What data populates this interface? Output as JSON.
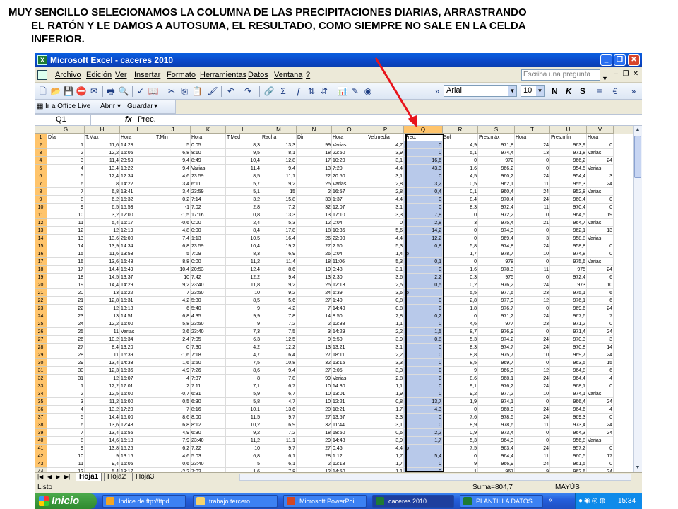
{
  "caption": {
    "line1": "MUY SENCILLO SELECIONAMOS LA COLUMNA DE LAS PRECIPITACIONES DIARIAS, ARRASTRANDO",
    "line2": "EL RATÓN Y LE DAMOS A AUTOSUMA, EL RESULTADO, COMO SIEMPRE NO SALE EN LA CELDA",
    "line3": "INFERIOR."
  },
  "window": {
    "title": "Microsoft Excel - caceres 2010"
  },
  "menu": [
    "Archivo",
    "Edición",
    "Ver",
    "Insertar",
    "Formato",
    "Herramientas",
    "Datos",
    "Ventana",
    "?"
  ],
  "help_placeholder": "Escriba una pregunta",
  "toolbar": {
    "font": "Arial",
    "size": "10",
    "bold": "N",
    "italic": "K",
    "underline": "S"
  },
  "toolbar2": {
    "office_live": "Ir a Office Live",
    "open": "Abrir",
    "save": "Guardar"
  },
  "formula": {
    "namebox": "Q1",
    "fx": "fx",
    "value": "Prec."
  },
  "columns": [
    "G",
    "H",
    "I",
    "J",
    "K",
    "L",
    "M",
    "N",
    "O",
    "P",
    "Q",
    "R",
    "S",
    "T",
    "U",
    "V"
  ],
  "headers": [
    "Día",
    "T.Max",
    "Hora",
    "T.Min",
    "Hora",
    "T.Med",
    "Racha",
    "Dir",
    "Hora",
    "Vel.media",
    "Prec.",
    "Sol",
    "Pres.máx",
    "Hora",
    "Pres.mín",
    "Hora"
  ],
  "rows": [
    [
      "1",
      "11,6",
      "14:28",
      "5",
      "0:05",
      "8,3",
      "13,3",
      "99",
      "Varias",
      "4,7",
      "0",
      "4,9",
      "971,8",
      "24",
      "963,9",
      "0"
    ],
    [
      "2",
      "12,2",
      "15:05",
      "6,8",
      "8:10",
      "9,5",
      "8,1",
      "18",
      "22:50",
      "3,9",
      "0",
      "5,1",
      "974,4",
      "13",
      "971,8",
      "Varias"
    ],
    [
      "3",
      "11,4",
      "23:59",
      "9,4",
      "8:49",
      "10,4",
      "12,8",
      "17",
      "10:20",
      "3,1",
      "16,6",
      "0",
      "972",
      "0",
      "966,2",
      "24"
    ],
    [
      "4",
      "13,4",
      "13:22",
      "9,4",
      "Varias",
      "11,4",
      "9,4",
      "13",
      "7:20",
      "4,4",
      "43,3",
      "1,6",
      "966,2",
      "0",
      "954,5",
      "Varias"
    ],
    [
      "5",
      "12,4",
      "12:34",
      "4,6",
      "23:59",
      "8,5",
      "11,1",
      "22",
      "20:50",
      "3,1",
      "0",
      "4,5",
      "960,2",
      "24",
      "954,4",
      "3"
    ],
    [
      "6",
      "8",
      "14:22",
      "3,4",
      "6:11",
      "5,7",
      "9,2",
      "25",
      "Varias",
      "2,8",
      "3,2",
      "0,5",
      "962,1",
      "11",
      "955,3",
      "24"
    ],
    [
      "7",
      "6,8",
      "13:41",
      "3,4",
      "23:59",
      "5,1",
      "15",
      "2",
      "16:57",
      "2,8",
      "0,4",
      "0,1",
      "960,4",
      "24",
      "952,8",
      "Varias"
    ],
    [
      "8",
      "6,2",
      "15:32",
      "0,2",
      "7:14",
      "3,2",
      "15,8",
      "33",
      "1:37",
      "4,4",
      "0",
      "8,4",
      "970,4",
      "24",
      "960,4",
      "0"
    ],
    [
      "9",
      "6,5",
      "15:53",
      "-1",
      "7:02",
      "2,8",
      "7,2",
      "32",
      "12:07",
      "3,1",
      "0",
      "8,3",
      "972,4",
      "11",
      "970,4",
      "0"
    ],
    [
      "10",
      "3,2",
      "12:00",
      "-1,5",
      "17:16",
      "0,8",
      "13,3",
      "13",
      "17:10",
      "3,3",
      "7,8",
      "0",
      "972,2",
      "0",
      "964,5",
      "19"
    ],
    [
      "11",
      "5,4",
      "16:17",
      "-0,6",
      "0:00",
      "2,4",
      "5,3",
      "12",
      "0:04",
      "0",
      "2,8",
      "3",
      "975,4",
      "21",
      "964,7",
      "Varias"
    ],
    [
      "12",
      "12",
      "12:19",
      "4,8",
      "0:00",
      "8,4",
      "17,8",
      "18",
      "10:35",
      "5,6",
      "14,2",
      "0",
      "974,3",
      "0",
      "962,1",
      "13"
    ],
    [
      "13",
      "13,6",
      "21:00",
      "7,4",
      "1:13",
      "10,5",
      "16,4",
      "26",
      "22:00",
      "4,4",
      "12,2",
      "0",
      "969,4",
      "3",
      "958,8",
      "Varias"
    ],
    [
      "14",
      "13,9",
      "14:34",
      "6,8",
      "23:59",
      "10,4",
      "19,2",
      "27",
      "2:50",
      "5,3",
      "0,8",
      "5,8",
      "974,8",
      "24",
      "958,8",
      "0"
    ],
    [
      "15",
      "11,6",
      "13:53",
      "5",
      "7:09",
      "8,3",
      "6,9",
      "26",
      "0:04",
      "1,4",
      "Ip",
      "1,7",
      "978,7",
      "10",
      "974,8",
      "0"
    ],
    [
      "16",
      "13,6",
      "16:48",
      "8,8",
      "0:00",
      "11,2",
      "11,4",
      "18",
      "11:06",
      "5,3",
      "0,1",
      "0",
      "978",
      "0",
      "975,6",
      "Varias"
    ],
    [
      "17",
      "14,4",
      "15:49",
      "10,4",
      "20:53",
      "12,4",
      "8,6",
      "19",
      "0:48",
      "3,1",
      "0",
      "1,6",
      "978,3",
      "11",
      "975",
      "24"
    ],
    [
      "18",
      "14,5",
      "13:37",
      "10",
      "7:42",
      "12,2",
      "9,4",
      "13",
      "2:30",
      "3,6",
      "2,2",
      "0,3",
      "975",
      "0",
      "972,4",
      "6"
    ],
    [
      "19",
      "14,4",
      "14:29",
      "9,2",
      "23:40",
      "11,8",
      "9,2",
      "25",
      "12:13",
      "2,5",
      "0,5",
      "0,2",
      "976,2",
      "24",
      "973",
      "10"
    ],
    [
      "20",
      "13",
      "15:22",
      "7",
      "23:50",
      "10",
      "9,2",
      "24",
      "5:39",
      "3,6",
      "Ip",
      "5,5",
      "977,6",
      "23",
      "975,1",
      "6"
    ],
    [
      "21",
      "12,8",
      "15:31",
      "4,2",
      "5:30",
      "8,5",
      "5,6",
      "27",
      "1:40",
      "0,8",
      "0",
      "2,8",
      "977,9",
      "12",
      "976,1",
      "6"
    ],
    [
      "22",
      "12",
      "13:18",
      "6",
      "5:40",
      "9",
      "4,2",
      "7",
      "14:40",
      "0,8",
      "0",
      "1,8",
      "976,7",
      "0",
      "969,6",
      "24"
    ],
    [
      "23",
      "13",
      "14:51",
      "6,8",
      "4:35",
      "9,9",
      "7,8",
      "14",
      "8:50",
      "2,8",
      "0,2",
      "0",
      "971,2",
      "24",
      "967,6",
      "7"
    ],
    [
      "24",
      "12,2",
      "16:00",
      "5,8",
      "23:50",
      "9",
      "7,2",
      "2",
      "12:38",
      "1,1",
      "0",
      "4,6",
      "977",
      "23",
      "971,2",
      "0"
    ],
    [
      "25",
      "11",
      "Varias",
      "3,6",
      "23:40",
      "7,3",
      "7,5",
      "3",
      "14:29",
      "2,2",
      "1,5",
      "8,7",
      "976,9",
      "0",
      "971,4",
      "24"
    ],
    [
      "26",
      "10,2",
      "15:34",
      "2,4",
      "7:05",
      "6,3",
      "12,5",
      "9",
      "5:50",
      "3,9",
      "0,8",
      "5,3",
      "974,2",
      "24",
      "970,3",
      "3"
    ],
    [
      "27",
      "8,4",
      "13:20",
      "0",
      "7:30",
      "4,2",
      "12,2",
      "13",
      "13:21",
      "3,1",
      "0",
      "8,3",
      "974,7",
      "24",
      "970,8",
      "14"
    ],
    [
      "28",
      "11",
      "16:39",
      "-1,6",
      "7:18",
      "4,7",
      "6,4",
      "27",
      "18:11",
      "2,2",
      "0",
      "8,8",
      "975,7",
      "10",
      "969,7",
      "24"
    ],
    [
      "29",
      "13,4",
      "14:33",
      "1,6",
      "1:50",
      "7,5",
      "10,8",
      "32",
      "13:15",
      "3,3",
      "0",
      "8,5",
      "969,7",
      "0",
      "963,5",
      "15"
    ],
    [
      "30",
      "12,3",
      "15:36",
      "4,9",
      "7:26",
      "8,6",
      "9,4",
      "27",
      "3:05",
      "3,3",
      "0",
      "9",
      "966,3",
      "12",
      "964,8",
      "6"
    ],
    [
      "31",
      "12",
      "15:07",
      "4",
      "7:37",
      "8",
      "7,8",
      "99",
      "Varias",
      "2,8",
      "0",
      "8,6",
      "968,1",
      "24",
      "964,4",
      "4"
    ],
    [
      "1",
      "12,2",
      "17:01",
      "2",
      "7:11",
      "7,1",
      "6,7",
      "10",
      "14:30",
      "1,1",
      "0",
      "9,1",
      "976,2",
      "24",
      "968,1",
      "0"
    ],
    [
      "2",
      "12,5",
      "15:00",
      "-0,7",
      "6:31",
      "5,9",
      "6,7",
      "10",
      "13:01",
      "1,9",
      "0",
      "9,2",
      "977,2",
      "10",
      "974,1",
      "Varias"
    ],
    [
      "3",
      "11,2",
      "15:00",
      "0,5",
      "6:30",
      "5,8",
      "4,7",
      "10",
      "12:21",
      "0,8",
      "13,7",
      "1,9",
      "974,1",
      "0",
      "966,4",
      "24"
    ],
    [
      "4",
      "13,2",
      "17:20",
      "7",
      "8:16",
      "10,1",
      "13,6",
      "20",
      "18:21",
      "1,7",
      "4,3",
      "0",
      "968,9",
      "24",
      "964,6",
      "4"
    ],
    [
      "5",
      "14,4",
      "15:00",
      "8,6",
      "8:00",
      "11,5",
      "9,7",
      "27",
      "13:57",
      "3,3",
      "0",
      "7,6",
      "978,5",
      "24",
      "969,3",
      "0"
    ],
    [
      "6",
      "13,6",
      "12:43",
      "6,8",
      "8:12",
      "10,2",
      "6,9",
      "32",
      "11:44",
      "3,1",
      "0",
      "8,9",
      "978,6",
      "11",
      "973,4",
      "24"
    ],
    [
      "7",
      "13,4",
      "15:55",
      "4,9",
      "6:30",
      "9,2",
      "7,2",
      "18",
      "18:50",
      "0,6",
      "2,2",
      "0,9",
      "973,4",
      "0",
      "964,3",
      "24"
    ],
    [
      "8",
      "14,6",
      "15:18",
      "7,9",
      "23:40",
      "11,2",
      "11,1",
      "29",
      "14:48",
      "3,9",
      "1,7",
      "5,3",
      "964,3",
      "0",
      "956,8",
      "Varias"
    ],
    [
      "9",
      "13,8",
      "15:26",
      "6,2",
      "7:22",
      "10",
      "9,7",
      "27",
      "0:46",
      "4,4",
      "Ip",
      "7,5",
      "963,4",
      "24",
      "957,2",
      "0"
    ],
    [
      "10",
      "9",
      "13:16",
      "4,6",
      "5:03",
      "6,8",
      "6,1",
      "28",
      "1:12",
      "1,7",
      "5,4",
      "0",
      "964,4",
      "11",
      "960,5",
      "17"
    ],
    [
      "11",
      "9,4",
      "16:05",
      "0,6",
      "23:40",
      "5",
      "6,1",
      "2",
      "12:18",
      "1,7",
      "0",
      "9",
      "966,9",
      "24",
      "961,5",
      "0"
    ],
    [
      "12",
      "5,4",
      "13:17",
      "-2,2",
      "7:02",
      "1,6",
      "7,8",
      "12",
      "14:50",
      "1,1",
      "0",
      "1",
      "967",
      "9",
      "962,6",
      "24"
    ]
  ],
  "sheets": [
    "Hoja1",
    "Hoja2",
    "Hoja3"
  ],
  "status": {
    "ready": "Listo",
    "sum": "Suma=804,7",
    "caps": "MAYÚS"
  },
  "taskbar": {
    "start": "Inicio",
    "items": [
      "Índice de ftp://ftpd...",
      "trabajo tercero",
      "Microsoft PowerPoi...",
      "caceres 2010",
      "PLANTILLA DATOS ..."
    ],
    "clock": "15:34"
  }
}
